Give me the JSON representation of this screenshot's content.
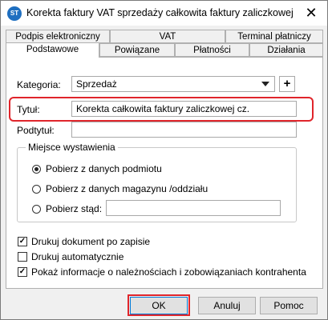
{
  "window": {
    "title": "Korekta faktury VAT sprzedaży całkowita faktury zaliczkowej",
    "app_icon": "app-logo-icon",
    "close_glyph": "✕"
  },
  "tabs_row1": [
    {
      "label": "Podpis elektroniczny"
    },
    {
      "label": "VAT"
    },
    {
      "label": "Terminal płatniczy"
    }
  ],
  "tabs_row2": [
    {
      "label": "Podstawowe",
      "active": true
    },
    {
      "label": "Powiązane"
    },
    {
      "label": "Płatności"
    },
    {
      "label": "Działania"
    }
  ],
  "form": {
    "kategoria_label": "Kategoria:",
    "kategoria_value": "Sprzedaż",
    "add_glyph": "+",
    "tytul_label": "Tytuł:",
    "tytul_value": "Korekta całkowita faktury zaliczkowej cz.",
    "podtytul_label": "Podtytuł:",
    "podtytul_value": ""
  },
  "miejsce": {
    "title": "Miejsce wystawienia",
    "options": [
      {
        "label": "Pobierz z danych podmiotu",
        "checked": true
      },
      {
        "label": "Pobierz z danych magazynu /oddziału",
        "checked": false
      },
      {
        "label": "Pobierz stąd:",
        "checked": false
      }
    ],
    "stad_value": ""
  },
  "checkboxes": [
    {
      "label": "Drukuj dokument po zapisie",
      "checked": true,
      "mark": "✓"
    },
    {
      "label": "Drukuj automatycznie",
      "checked": false,
      "mark": ""
    },
    {
      "label": "Pokaż informacje o należnościach i zobowiązaniach kontrahenta",
      "checked": true,
      "mark": "✓"
    }
  ],
  "buttons": {
    "ok": "OK",
    "cancel": "Anuluj",
    "help": "Pomoc"
  },
  "colors": {
    "highlight": "#e0252b",
    "default_button_border": "#0078d7"
  }
}
